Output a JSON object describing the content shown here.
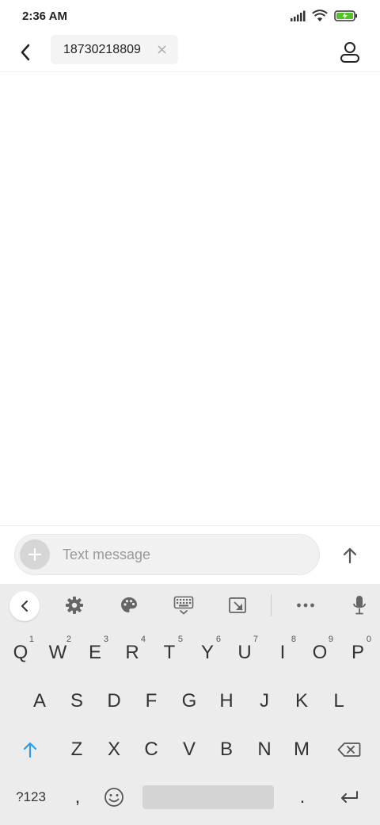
{
  "status_bar": {
    "time": "2:36 AM",
    "icons": [
      "signal-icon",
      "wifi-icon",
      "battery-charging-icon"
    ],
    "battery_color": "#53c22b"
  },
  "header": {
    "back_icon": "chevron-left-icon",
    "recipient": "18730218809",
    "clear_icon": "close-icon",
    "contact_icon": "person-icon"
  },
  "composer": {
    "attach_icon": "plus-icon",
    "message_value": "",
    "message_placeholder": "Text message",
    "send_icon": "arrow-up-icon"
  },
  "keyboard": {
    "toolbar": [
      "chevron-left-icon",
      "gear-icon",
      "palette-icon",
      "keyboard-icon",
      "resize-icon",
      "more-icon",
      "microphone-icon"
    ],
    "row1": [
      {
        "label": "Q",
        "hint": "1"
      },
      {
        "label": "W",
        "hint": "2"
      },
      {
        "label": "E",
        "hint": "3"
      },
      {
        "label": "R",
        "hint": "4"
      },
      {
        "label": "T",
        "hint": "5"
      },
      {
        "label": "Y",
        "hint": "6"
      },
      {
        "label": "U",
        "hint": "7"
      },
      {
        "label": "I",
        "hint": "8"
      },
      {
        "label": "O",
        "hint": "9"
      },
      {
        "label": "P",
        "hint": "0"
      }
    ],
    "row2": [
      "A",
      "S",
      "D",
      "F",
      "G",
      "H",
      "J",
      "K",
      "L"
    ],
    "row3": [
      "Z",
      "X",
      "C",
      "V",
      "B",
      "N",
      "M"
    ],
    "symbols_label": "?123",
    "comma_label": ",",
    "period_label": ".",
    "shift_icon": "shift-icon",
    "backspace_icon": "backspace-icon",
    "emoji_icon": "emoji-icon",
    "enter_icon": "enter-icon",
    "accent_color": "#2b9cf2"
  }
}
